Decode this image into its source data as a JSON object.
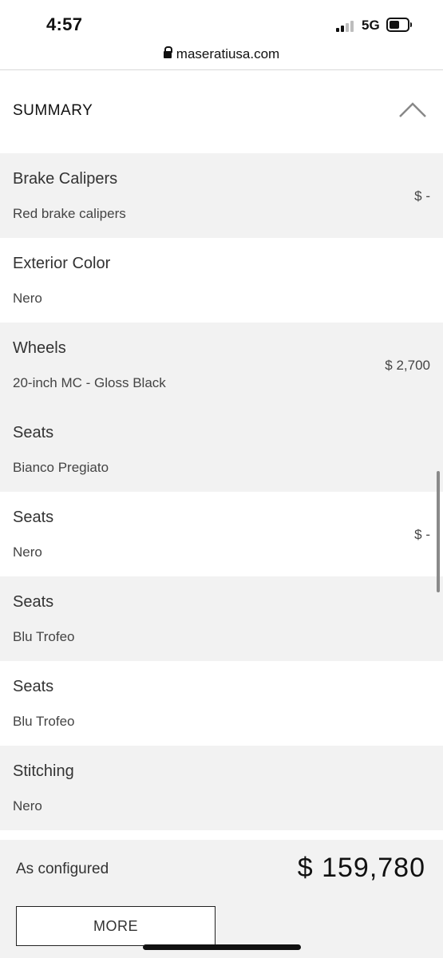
{
  "status_bar": {
    "time": "4:57",
    "network": "5G"
  },
  "browser": {
    "url": "maseratiusa.com"
  },
  "summary": {
    "title": "SUMMARY"
  },
  "items": [
    {
      "label": "Brake Calipers",
      "value": "Red brake calipers",
      "price": "$ -"
    },
    {
      "label": "Exterior Color",
      "value": "Nero",
      "price": ""
    },
    {
      "label": "Wheels",
      "value": "20-inch MC - Gloss Black",
      "price": "$ 2,700"
    },
    {
      "label": "Seats",
      "value": "Bianco Pregiato",
      "price": ""
    },
    {
      "label": "Seats",
      "value": "Nero",
      "price": "$ -"
    },
    {
      "label": "Seats",
      "value": "Blu Trofeo",
      "price": ""
    },
    {
      "label": "Seats",
      "value": "Blu Trofeo",
      "price": ""
    },
    {
      "label": "Stitching",
      "value": "Nero",
      "price": ""
    }
  ],
  "footer": {
    "configured_label": "As configured",
    "total": "$ 159,780",
    "more_label": "MORE"
  },
  "colors": {
    "row_gray": "#f2f2f2",
    "row_white": "#ffffff",
    "text": "#333333"
  }
}
